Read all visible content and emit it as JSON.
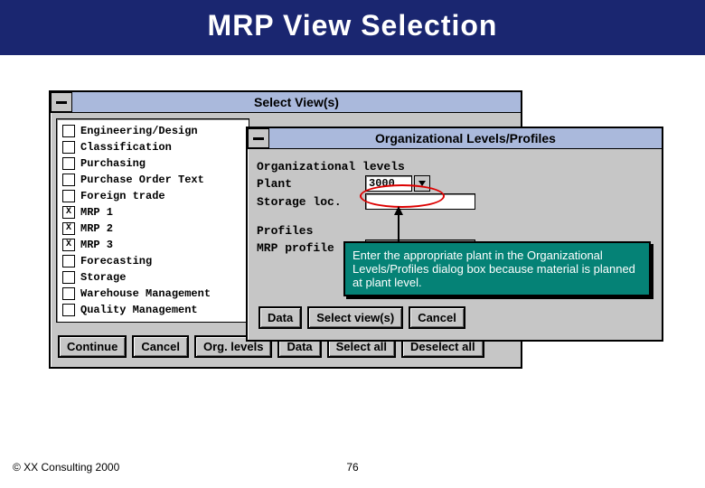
{
  "page_title": "MRP View Selection",
  "select_views": {
    "title": "Select View(s)",
    "items": [
      {
        "label": "Engineering/Design",
        "checked": false
      },
      {
        "label": "Classification",
        "checked": false
      },
      {
        "label": "Purchasing",
        "checked": false
      },
      {
        "label": "Purchase Order Text",
        "checked": false
      },
      {
        "label": "Foreign trade",
        "checked": false
      },
      {
        "label": "MRP 1",
        "checked": true
      },
      {
        "label": "MRP 2",
        "checked": true
      },
      {
        "label": "MRP 3",
        "checked": true,
        "focused": true
      },
      {
        "label": "Forecasting",
        "checked": false
      },
      {
        "label": "Storage",
        "checked": false
      },
      {
        "label": "Warehouse Management",
        "checked": false
      },
      {
        "label": "Quality Management",
        "checked": false
      }
    ],
    "buttons": {
      "continue": "Continue",
      "cancel": "Cancel",
      "org_levels": "Org. levels",
      "data": "Data",
      "select_all": "Select all",
      "deselect_all": "Deselect all"
    }
  },
  "org_levels": {
    "title": "Organizational Levels/Profiles",
    "section1": "Organizational levels",
    "plant_label": "Plant",
    "plant_value": "3000",
    "storage_label": "Storage loc.",
    "section2": "Profiles",
    "mrp_profile_label": "MRP profile",
    "buttons": {
      "data": "Data",
      "select_views": "Select view(s)",
      "cancel": "Cancel"
    }
  },
  "callout_text": "Enter the appropriate plant in the Organizational Levels/Profiles dialog box because material is planned at plant level.",
  "footer": {
    "copyright": "© XX Consulting 2000",
    "page_number": "76"
  }
}
